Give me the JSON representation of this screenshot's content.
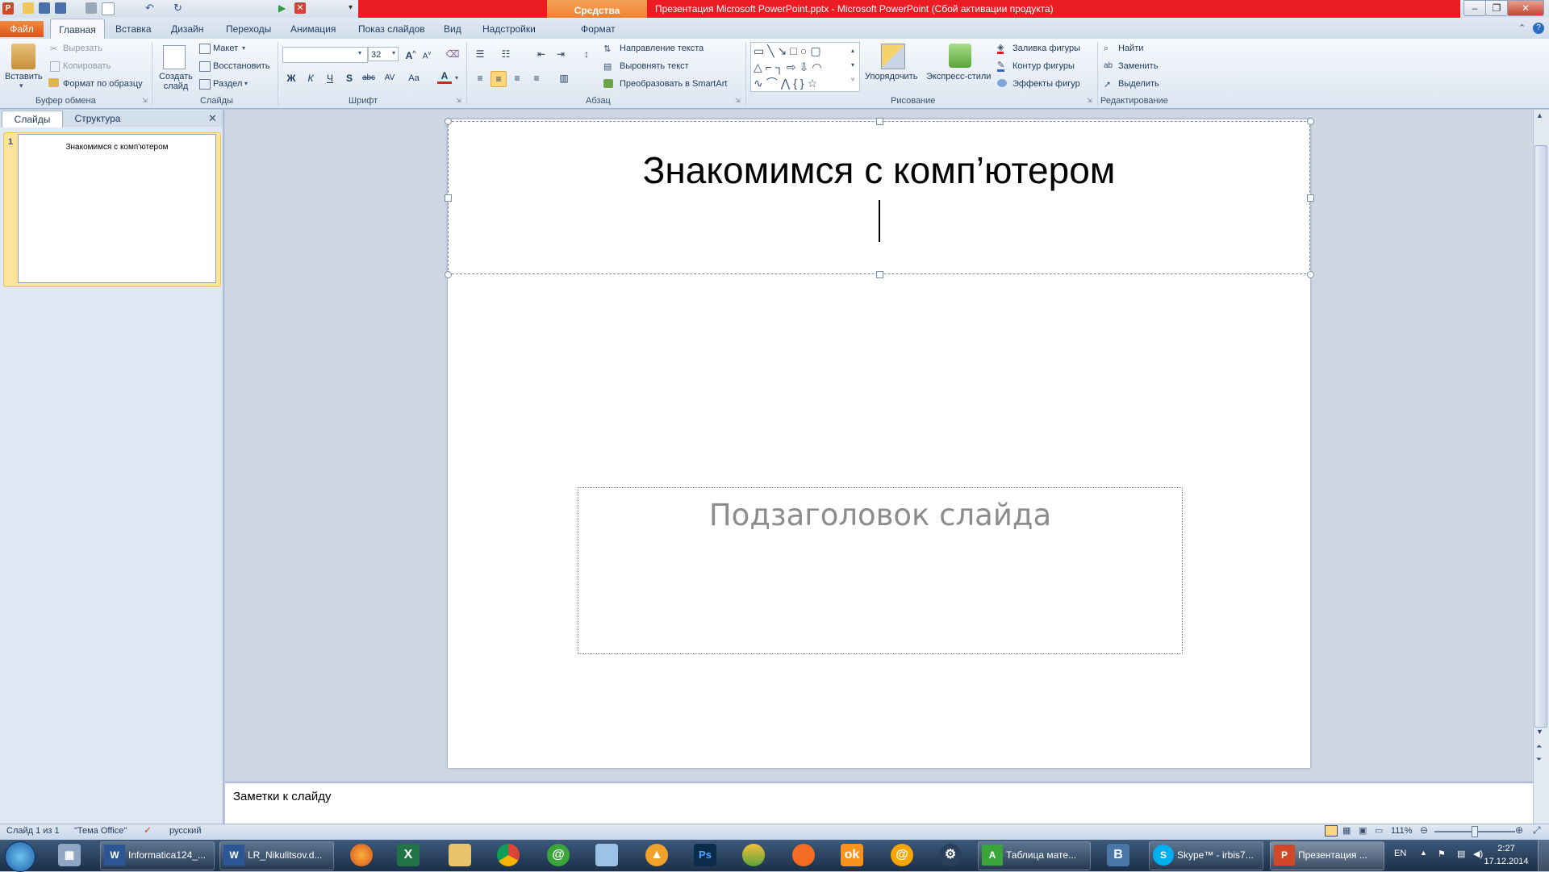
{
  "app": {
    "title": "Презентация Microsoft PowerPoint.pptx - Microsoft PowerPoint (Сбой активации продукта)",
    "contextual_tab_group": "Средства рисования"
  },
  "tabs": [
    {
      "label": "Файл"
    },
    {
      "label": "Главная"
    },
    {
      "label": "Вставка"
    },
    {
      "label": "Дизайн"
    },
    {
      "label": "Переходы"
    },
    {
      "label": "Анимация"
    },
    {
      "label": "Показ слайдов"
    },
    {
      "label": "Вид"
    },
    {
      "label": "Надстройки"
    },
    {
      "label": "Формат"
    }
  ],
  "ribbon": {
    "clipboard": {
      "paste": "Вставить",
      "cut": "Вырезать",
      "copy": "Копировать",
      "format_painter": "Формат по образцу",
      "group": "Буфер обмена"
    },
    "slides": {
      "new_slide": "Создать слайд",
      "layout": "Макет",
      "reset": "Восстановить",
      "section": "Раздел",
      "group": "Слайды"
    },
    "font": {
      "font_name": "",
      "font_size": "32",
      "bold": "Ж",
      "italic": "К",
      "underline": "Ч",
      "strike": "S",
      "strike2": "abc",
      "spacing": "AV",
      "case": "Aa",
      "color": "A",
      "group": "Шрифт"
    },
    "paragraph": {
      "text_direction": "Направление текста",
      "align_text": "Выровнять текст",
      "smartart": "Преобразовать в SmartArt",
      "group": "Абзац"
    },
    "drawing": {
      "arrange": "Упорядочить",
      "quick_styles": "Экспресс-стили",
      "fill": "Заливка фигуры",
      "outline": "Контур фигуры",
      "effects": "Эффекты фигур",
      "group": "Рисование"
    },
    "editing": {
      "find": "Найти",
      "replace": "Заменить",
      "select": "Выделить",
      "group": "Редактирование"
    }
  },
  "left_pane": {
    "tabs": [
      "Слайды",
      "Структура"
    ],
    "slide_number": "1",
    "thumb_title": "Знакомимся с комп'ютером"
  },
  "slide": {
    "title": "Знакомимся с комп’ютером",
    "subtitle_placeholder": "Подзаголовок слайда"
  },
  "notes": {
    "placeholder": "Заметки к слайду"
  },
  "status": {
    "slide_of": "Слайд 1 из 1",
    "theme": "\"Тема Office\"",
    "language": "русский",
    "zoom": "111%"
  },
  "taskbar": {
    "items": [
      {
        "label": "Informatica124_..."
      },
      {
        "label": "LR_Nikulitsov.d..."
      },
      {
        "label": "Таблица мате..."
      },
      {
        "label": "Skype™ - irbis7..."
      },
      {
        "label": "Презентация ..."
      }
    ],
    "lang": "EN",
    "time": "2:27",
    "date": "17.12.2014"
  }
}
